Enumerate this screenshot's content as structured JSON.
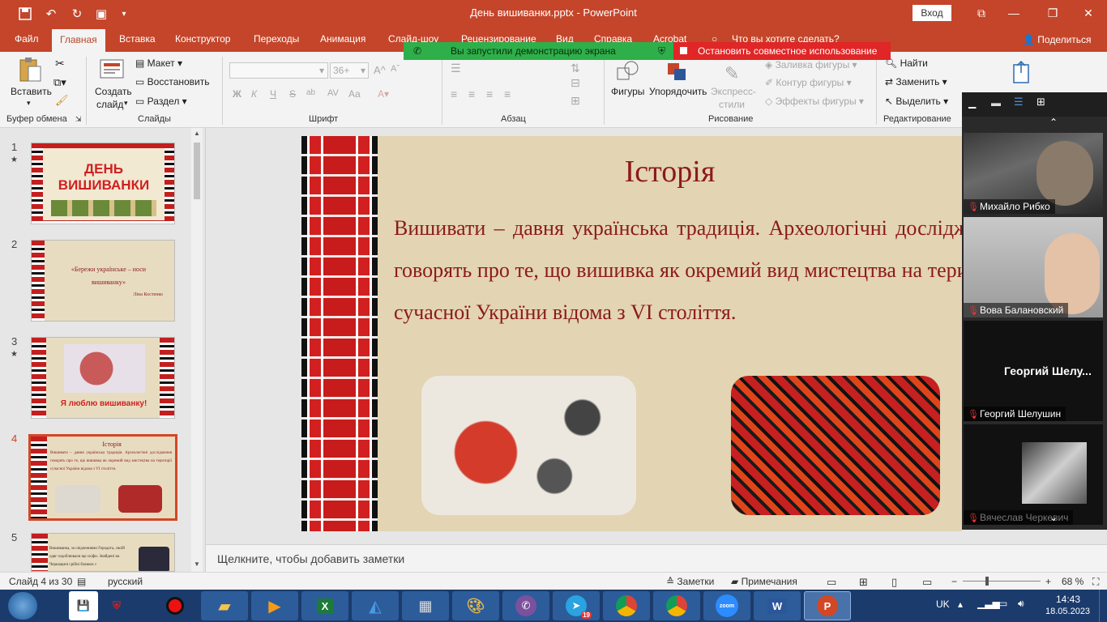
{
  "window": {
    "title": "День вишиванки.pptx  -  PowerPoint",
    "login": "Вход"
  },
  "tabs": [
    "Файл",
    "Главная",
    "Вставка",
    "Конструктор",
    "Переходы",
    "Анимация",
    "Слайд-шоу",
    "Рецензирование",
    "Вид",
    "Справка",
    "Acrobat"
  ],
  "search_hint": "Что вы хотите сделать?",
  "share_label": "Поделиться",
  "banners": {
    "green": "Вы запустили демонстрацию экрана",
    "red": "Остановить совместное использование"
  },
  "ribbon": {
    "paste": "Вставить",
    "clipboard": "Буфер обмена",
    "new_slide_1": "Создать",
    "new_slide_2": "слайд",
    "layout": "Макет",
    "reset": "Восстановить",
    "section": "Раздел",
    "slides": "Слайды",
    "font_size": "36+",
    "font_buttons": [
      "Ж",
      "К",
      "Ч",
      "S",
      "ab",
      "AV",
      "Aa"
    ],
    "font": "Шрифт",
    "paragraph": "Абзац",
    "shapes": "Фигуры",
    "arrange": "Упорядочить",
    "quick_styles_1": "Экспресс-",
    "quick_styles_2": "стили",
    "shape_fill": "Заливка фигуры",
    "shape_outline": "Контур фигуры",
    "shape_effects": "Эффекты фигуры",
    "drawing": "Рисование",
    "find": "Найти",
    "replace": "Заменить",
    "select": "Выделить",
    "editing": "Редактирование"
  },
  "thumbnails": [
    {
      "num": "1",
      "star": "★",
      "title": "ДЕНЬ ВИШИВАНКИ"
    },
    {
      "num": "2",
      "star": "",
      "quote": "«Бережи українське – носи вишиванку»",
      "author": "Ліна Костенко"
    },
    {
      "num": "3",
      "star": "★",
      "caption": "Я люблю вишиванку!"
    },
    {
      "num": "4",
      "star": "",
      "title": "Історія",
      "body": "Вишивати – давня українська традиція. Археологічні дослідження говорять про те, що вишивка як окремий вид мистецтва на території сучасної України відома з VI століття."
    },
    {
      "num": "5",
      "star": "",
      "body": "Вишиванка, за свідченнями Геродота, своїй одяг оздоблювали ще скіфи. Знайдені на Черкащині срібні бляшки з"
    }
  ],
  "slide": {
    "title": "Історія",
    "body": "Вишивати – давня українська традиція. Археологічні дослідження говорять про те, що вишивка як окремий вид мистецтва на території сучасної України відома з VI століття."
  },
  "notes_placeholder": "Щелкните, чтобы добавить заметки",
  "status": {
    "slide_info": "Слайд 4 из 30",
    "language": "русский",
    "notes": "Заметки",
    "comments": "Примечания",
    "zoom": "68 %"
  },
  "participants": [
    {
      "name": "Михайло Рибко"
    },
    {
      "name": "Вова Балановский"
    },
    {
      "name": "Георгий Шелу...",
      "full": "Георгий Шелушин"
    },
    {
      "name": "Вячеслав Черкевич"
    }
  ],
  "taskbar": {
    "time": "14:43",
    "date": "18.05.2023",
    "lang": "UK",
    "badges": {
      "telegram": "19"
    }
  }
}
